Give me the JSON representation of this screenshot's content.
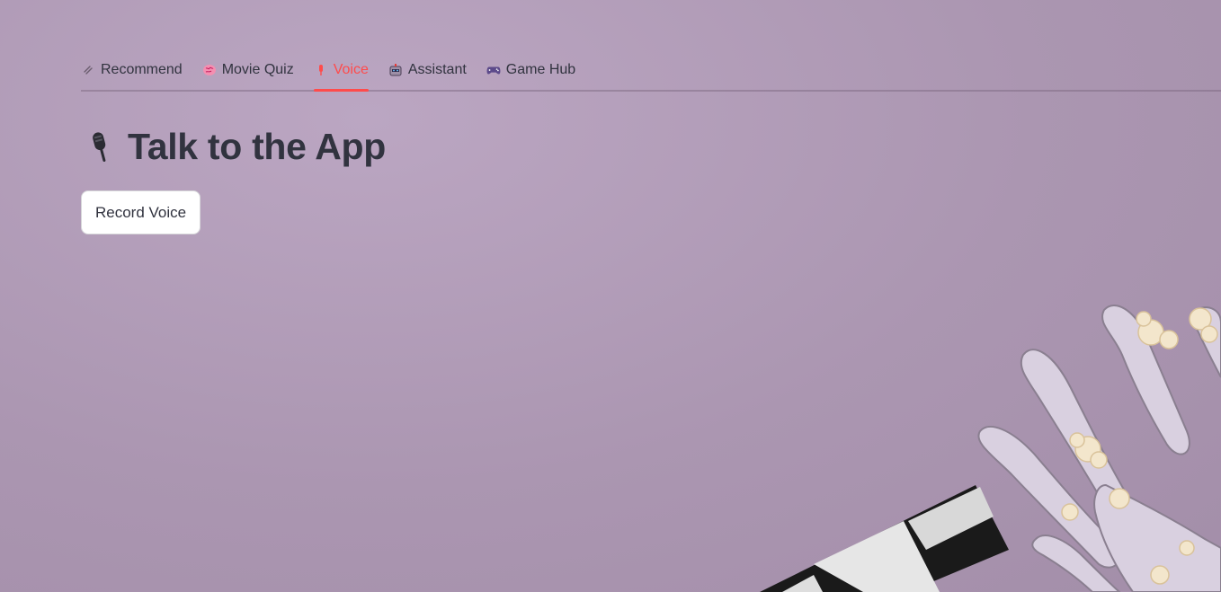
{
  "tabs": [
    {
      "label": "Recommend",
      "icon": "link-icon"
    },
    {
      "label": "Movie Quiz",
      "icon": "brain-icon"
    },
    {
      "label": "Voice",
      "icon": "microphone-icon",
      "active": true
    },
    {
      "label": "Assistant",
      "icon": "robot-icon"
    },
    {
      "label": "Game Hub",
      "icon": "gamepad-icon"
    }
  ],
  "page": {
    "title": "Talk to the App",
    "title_icon": "microphone-icon"
  },
  "actions": {
    "record_label": "Record Voice"
  },
  "colors": {
    "accent": "#ff4b4b",
    "background": "#ab96b1",
    "text": "#31333f"
  }
}
